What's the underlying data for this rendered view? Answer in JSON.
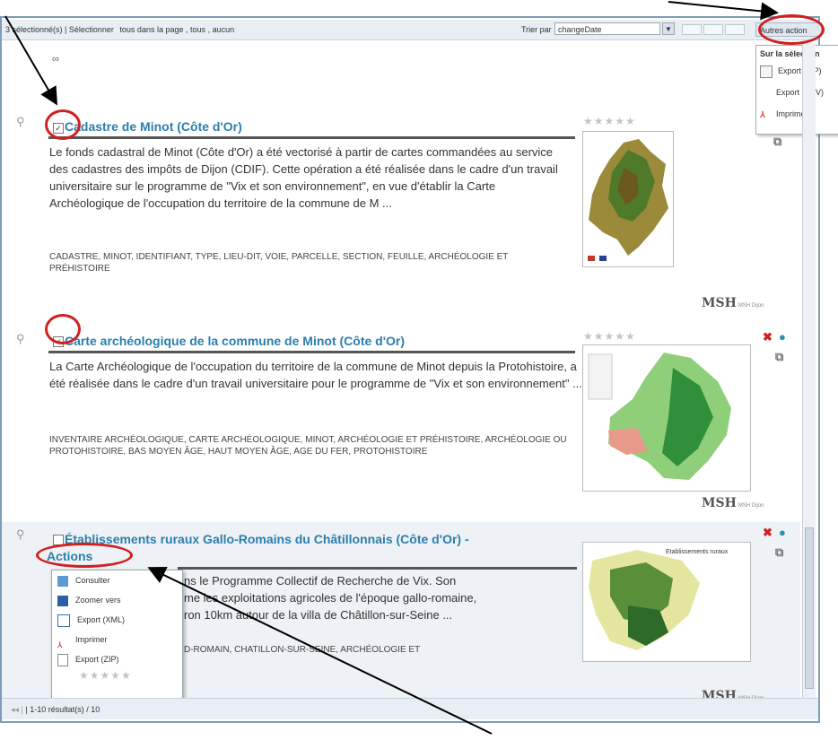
{
  "toolbar": {
    "selection_text": "3 sélectionné(s) | Sélectionner",
    "select_page": "tous dans la page",
    "select_all": "tous",
    "select_none": "aucun",
    "sort_label": "Trier par",
    "sort_value": "changeDate",
    "other_actions": "Autres action"
  },
  "selection_menu": {
    "header": "Sur la sélection",
    "items": [
      {
        "label": "Export (ZIP)",
        "icon": "zip-icon"
      },
      {
        "label": "Export (CSV)",
        "icon": "csv-icon"
      },
      {
        "label": "Imprimer",
        "icon": "pdf-icon"
      }
    ]
  },
  "logo": {
    "text": "MSH",
    "subtitle": "MSH Dijon"
  },
  "results": [
    {
      "title": "Cadastre de Minot (Côte d'Or)",
      "checked": true,
      "abstract": "Le fonds cadastral de Minot (Côte d'Or) a été vectorisé à partir de cartes commandées au service des cadastres des impôts de Dijon (CDIF). Cette opération a été réalisée dans le cadre d'un travail universitaire sur le programme de \"Vix et son environnement\", en vue d'établir la Carte Archéologique de l'occupation du territoire de la commune de M ...",
      "keywords": "CADASTRE, MINOT, IDENTIFIANT, TYPE, LIEU-DIT, VOIE, PARCELLE, SECTION, FEUILLE, ARCHÉOLOGIE ET PRÉHISTOIRE"
    },
    {
      "title": "Carte archéologique de la commune de Minot (Côte d'Or)",
      "checked": true,
      "abstract": "La Carte Archéologique de l'occupation du territoire de la commune de Minot depuis la Protohistoire, a été réalisée dans le cadre d'un travail universitaire pour le programme de \"Vix et son environnement\" ...",
      "keywords": "INVENTAIRE ARCHÉOLOGIQUE, CARTE ARCHÉOLOGIQUE, MINOT, ARCHÉOLOGIE ET PRÉHISTOIRE, ARCHÉOLOGIE OU PROTOHISTOIRE, BAS MOYEN ÂGE, HAUT MOYEN ÂGE, AGE DU FER, PROTOHISTOIRE"
    },
    {
      "title": "Établissements ruraux Gallo-Romains du Châtillonnais (Côte d'Or) -",
      "checked": false,
      "abstract_line1": "ns le Programme Collectif de Recherche de Vix. Son",
      "abstract_line2": "me les exploitations agricoles de l'époque gallo-romaine,",
      "abstract_line3": "ron 10km autour de la villa de Châtillon-sur-Seine ...",
      "keywords": "D-ROMAIN, CHATILLON-SUR-SEINE, ARCHÉOLOGIE ET",
      "thumb_title": "Etablissements ruraux"
    }
  ],
  "actions_button": "Actions",
  "actions_menu": [
    {
      "label": "Consulter",
      "icon": "view-icon"
    },
    {
      "label": "Zoomer vers",
      "icon": "zoom-icon"
    },
    {
      "label": "Export (XML)",
      "icon": "xml-icon"
    },
    {
      "label": "Imprimer",
      "icon": "pdf-icon"
    },
    {
      "label": "Export (ZIP)",
      "icon": "zip-icon"
    }
  ],
  "footer": {
    "text": "| 1-10 résultat(s) / 10"
  },
  "colors": {
    "title": "#2b7fad",
    "highlight": "#d02020",
    "toolbar": "#e9eef4"
  }
}
